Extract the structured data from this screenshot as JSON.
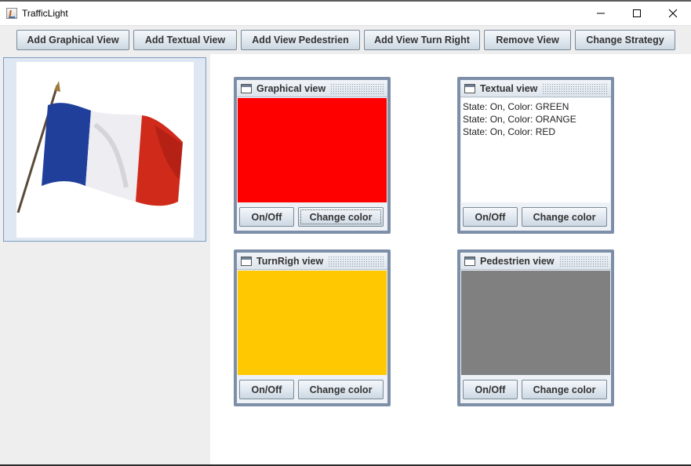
{
  "window": {
    "title": "TrafficLight",
    "controls": [
      "minimize-icon",
      "maximize-icon",
      "close-icon"
    ]
  },
  "toolbar": {
    "buttons": [
      {
        "label": "Add Graphical View"
      },
      {
        "label": "Add Textual View"
      },
      {
        "label": "Add View Pedestrien"
      },
      {
        "label": "Add View Turn Right"
      },
      {
        "label": "Remove View"
      },
      {
        "label": "Change Strategy"
      }
    ]
  },
  "flag_image": {
    "colors": {
      "blue": "#1f3f9a",
      "white": "#eeeeee",
      "red": "#d02a1a"
    }
  },
  "views": [
    {
      "title": "Graphical view",
      "type": "color",
      "color": "#ff0000",
      "onoff_label": "On/Off",
      "change_label": "Change color"
    },
    {
      "title": "Textual view",
      "type": "text",
      "lines": [
        "State: On, Color: GREEN",
        "State: On, Color: ORANGE",
        "State: On, Color: RED"
      ],
      "onoff_label": "On/Off",
      "change_label": "Change color"
    },
    {
      "title": "TurnRigh view",
      "type": "color",
      "color": "#ffc800",
      "onoff_label": "On/Off",
      "change_label": "Change color"
    },
    {
      "title": "Pedestrien view",
      "type": "color",
      "color": "#808080",
      "onoff_label": "On/Off",
      "change_label": "Change color"
    }
  ]
}
